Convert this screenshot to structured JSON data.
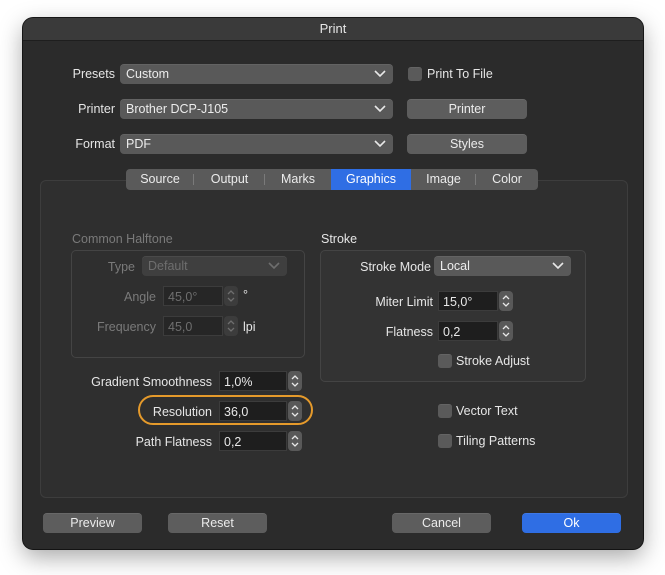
{
  "window": {
    "title": "Print"
  },
  "top": {
    "presets_label": "Presets",
    "presets_value": "Custom",
    "printer_label": "Printer",
    "printer_value": "Brother DCP-J105",
    "format_label": "Format",
    "format_value": "PDF",
    "print_to_file_label": "Print To File",
    "printer_button": "Printer",
    "styles_button": "Styles"
  },
  "tabs": [
    {
      "label": "Source"
    },
    {
      "label": "Output"
    },
    {
      "label": "Marks"
    },
    {
      "label": "Graphics",
      "active": true
    },
    {
      "label": "Image"
    },
    {
      "label": "Color"
    }
  ],
  "halftone": {
    "title": "Common Halftone",
    "type_label": "Type",
    "type_value": "Default",
    "angle_label": "Angle",
    "angle_value": "45,0°",
    "angle_unit": "°",
    "frequency_label": "Frequency",
    "frequency_value": "45,0",
    "frequency_unit": "lpi"
  },
  "stroke": {
    "title": "Stroke",
    "mode_label": "Stroke Mode",
    "mode_value": "Local",
    "miter_label": "Miter Limit",
    "miter_value": "15,0°",
    "flatness_label": "Flatness",
    "flatness_value": "0,2",
    "adjust_label": "Stroke Adjust"
  },
  "graphics": {
    "gradient_label": "Gradient Smoothness",
    "gradient_value": "1,0%",
    "resolution_label": "Resolution",
    "resolution_value": "36,0",
    "path_flatness_label": "Path Flatness",
    "path_flatness_value": "0,2",
    "vector_text_label": "Vector Text",
    "tiling_label": "Tiling Patterns"
  },
  "buttons": {
    "preview": "Preview",
    "reset": "Reset",
    "cancel": "Cancel",
    "ok": "Ok"
  },
  "colors": {
    "accent": "#2f6ee4",
    "highlight": "#e59a2b"
  }
}
